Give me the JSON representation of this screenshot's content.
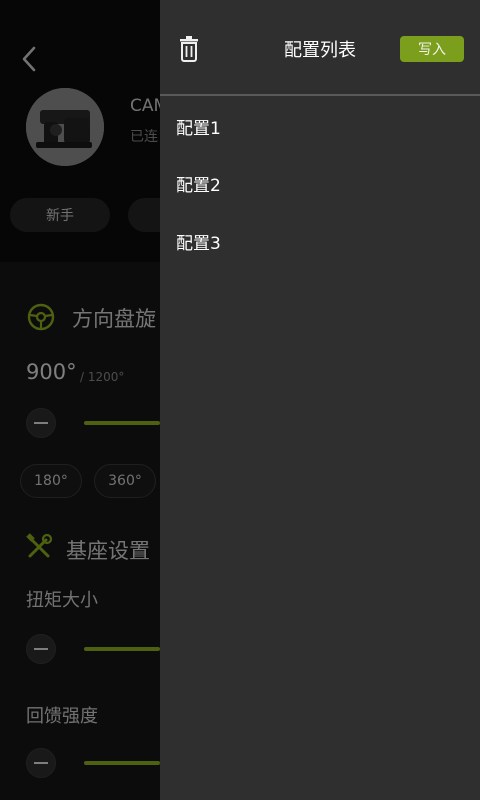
{
  "device": {
    "name": "CAM",
    "status": "已连"
  },
  "modes": [
    "新手",
    ""
  ],
  "sections": {
    "rotation": {
      "title": "方向盘旋",
      "value": "900°",
      "max": "/ 1200°",
      "presets": [
        "180°",
        "360°"
      ]
    },
    "base": {
      "title": "基座设置",
      "torque_label": "扭矩大小",
      "feedback_label": "回馈强度"
    }
  },
  "drawer": {
    "title": "配置列表",
    "write_label": "写入",
    "configs": [
      "配置1",
      "配置2",
      "配置3"
    ]
  },
  "icons": {
    "back": "chevron-left-icon",
    "trash": "trash-icon",
    "steering": "steering-wheel-icon",
    "tools": "tools-icon"
  },
  "colors": {
    "accent": "#7b9f1c",
    "drawer_bg": "#2f2f2f",
    "page_bg": "#171717"
  }
}
